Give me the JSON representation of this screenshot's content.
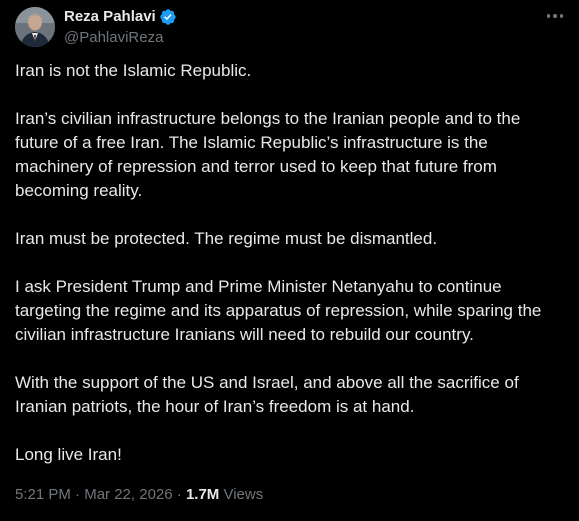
{
  "author": {
    "display_name": "Reza Pahlavi",
    "handle": "@PahlaviReza",
    "verified_icon": "verified-badge-icon",
    "avatar_icon": "profile-avatar",
    "accent_color": "#1d9bf0"
  },
  "post": {
    "paragraphs": [
      "Iran is not the Islamic Republic.",
      "Iran’s civilian infrastructure belongs to the Iranian people and to the future of a free Iran. The Islamic Republic’s infrastructure is the machinery of repression and terror used to keep that future from becoming reality.",
      "Iran must be protected. The regime must be dismantled.",
      "I ask President Trump and Prime Minister Netanyahu to continue targeting the regime and its apparatus of repression, while sparing the civilian infrastructure Iranians will need to rebuild our country.",
      "With the support of the US and Israel, and above all the sacrifice of Iranian patriots, the hour of Iran’s freedom is at hand.",
      "Long live Iran!"
    ]
  },
  "meta": {
    "time": "5:21 PM",
    "separator": " · ",
    "date": "Mar 22, 2026",
    "views_count": "1.7M",
    "views_label": " Views"
  },
  "icons": {
    "more": "more-options-icon"
  },
  "colors": {
    "background": "#000000",
    "text": "#e7e9ea",
    "secondary_text": "#71767b"
  }
}
